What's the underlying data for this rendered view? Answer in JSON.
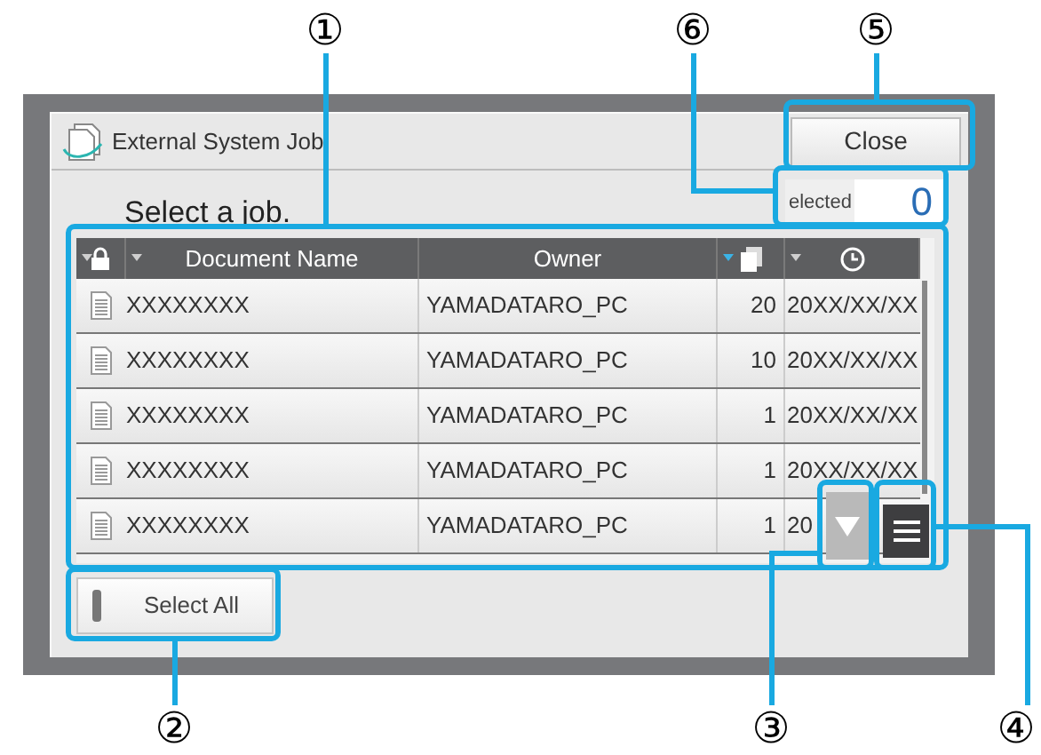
{
  "window": {
    "title": "External System Job",
    "close_button": "Close"
  },
  "prompt": "Select a job.",
  "selected_counter": {
    "label": "elected",
    "value": "0"
  },
  "table": {
    "columns": [
      {
        "kind": "lock",
        "sort_caret": true,
        "sort_active": false
      },
      {
        "kind": "text",
        "label": "Document Name",
        "sort_caret": true,
        "sort_active": false
      },
      {
        "kind": "text",
        "label": "Owner",
        "sort_caret": false
      },
      {
        "kind": "copies",
        "sort_caret": true,
        "sort_active": true
      },
      {
        "kind": "clock",
        "sort_caret": true,
        "sort_active": false
      }
    ],
    "rows": [
      {
        "name": "XXXXXXXX",
        "owner": "YAMADATARO_PC",
        "copies": "20",
        "date": "20XX/XX/XX"
      },
      {
        "name": "XXXXXXXX",
        "owner": "YAMADATARO_PC",
        "copies": "10",
        "date": "20XX/XX/XX"
      },
      {
        "name": "XXXXXXXX",
        "owner": "YAMADATARO_PC",
        "copies": "1",
        "date": "20XX/XX/XX"
      },
      {
        "name": "XXXXXXXX",
        "owner": "YAMADATARO_PC",
        "copies": "1",
        "date": "20XX/XX/XX"
      },
      {
        "name": "XXXXXXXX",
        "owner": "YAMADATARO_PC",
        "copies": "1",
        "date": "20"
      }
    ]
  },
  "select_all_button": "Select All",
  "callouts": [
    "①",
    "⑥",
    "⑤",
    "②",
    "③",
    "④"
  ]
}
